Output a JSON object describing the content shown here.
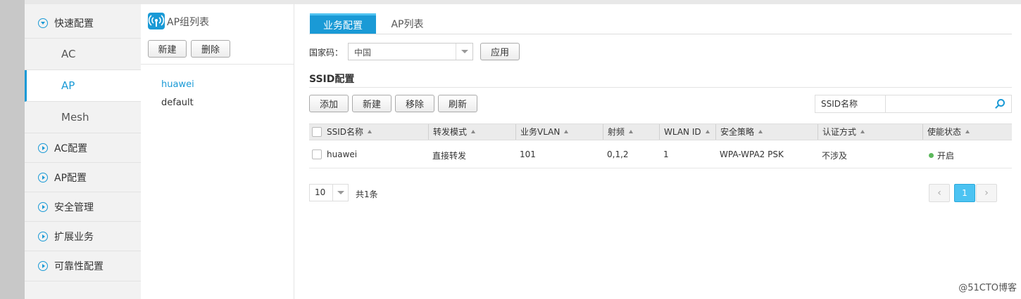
{
  "sidebar": {
    "quick_config": "快速配置",
    "sub_items": [
      "AC",
      "AP",
      "Mesh"
    ],
    "active_sub": "AP",
    "sections": [
      "AC配置",
      "AP配置",
      "安全管理",
      "扩展业务",
      "可靠性配置"
    ]
  },
  "group_panel": {
    "title": "AP组列表",
    "new_label": "新建",
    "delete_label": "删除",
    "groups": [
      "huawei",
      "default"
    ]
  },
  "tabs": [
    "业务配置",
    "AP列表"
  ],
  "country": {
    "label": "国家码：",
    "value": "中国",
    "apply_label": "应用"
  },
  "ssid_section": {
    "title": "SSID配置",
    "buttons": {
      "add": "添加",
      "new": "新建",
      "remove": "移除",
      "refresh": "刷新"
    },
    "search_label": "SSID名称",
    "search_value": ""
  },
  "table": {
    "columns": [
      "SSID名称",
      "转发模式",
      "业务VLAN",
      "射频",
      "WLAN ID",
      "安全策略",
      "认证方式",
      "使能状态"
    ],
    "rows": [
      {
        "ssid": "huawei",
        "mode": "直接转发",
        "vlan": "101",
        "radio": "0,1,2",
        "wlan_id": "1",
        "security": "WPA-WPA2 PSK",
        "auth": "不涉及",
        "status": "开启"
      }
    ]
  },
  "pagination": {
    "page_size": "10",
    "total_text": "共1条",
    "current_page": "1",
    "prev_symbol": "‹",
    "next_symbol": "›"
  },
  "watermark": "@51CTO博客",
  "colors": {
    "accent": "#1a9ad6",
    "status_on": "#5cb85c",
    "page_active": "#4cc3f2"
  }
}
